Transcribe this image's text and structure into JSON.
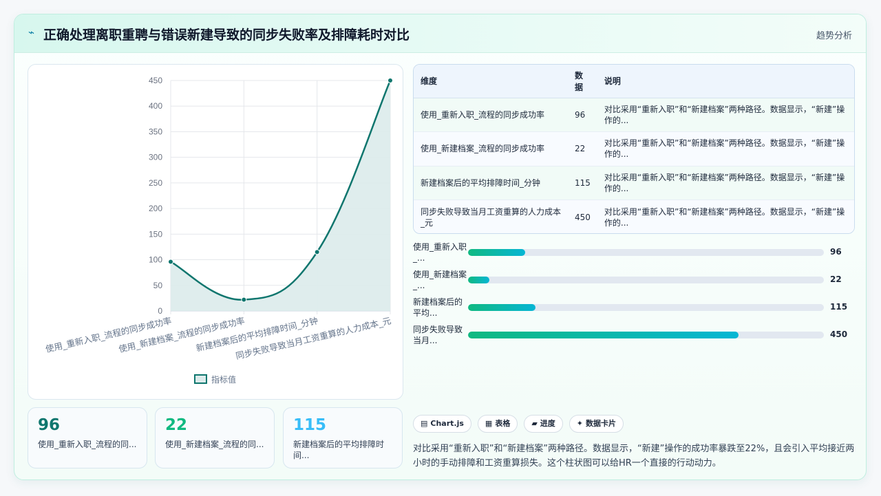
{
  "header": {
    "icon": "lightning-icon",
    "title": "正确处理离职重聘与错误新建导致的同步失败率及排障耗时对比",
    "tag": "趋势分析"
  },
  "chart_data": {
    "type": "line",
    "categories": [
      "使用_重新入职_流程的同步成功率",
      "使用_新建档案_流程的同步成功率",
      "新建档案后的平均排障时间_分钟",
      "同步失败导致当月工资重算的人力成本_元"
    ],
    "series": [
      {
        "name": "指标值",
        "values": [
          96,
          22,
          115,
          450
        ]
      }
    ],
    "ylim": [
      0,
      450
    ],
    "yticks": [
      0,
      50,
      100,
      150,
      200,
      250,
      300,
      350,
      400,
      450
    ],
    "grid": true,
    "legend": "bottom",
    "color": "#0f766e",
    "fill": "#dcebeb"
  },
  "table": {
    "headers": [
      "维度",
      "数据",
      "说明"
    ],
    "rows": [
      {
        "dim": "使用_重新入职_流程的同步成功率",
        "value": "96",
        "note": "对比采用“重新入职”和“新建档案”两种路径。数据显示，“新建”操作的..."
      },
      {
        "dim": "使用_新建档案_流程的同步成功率",
        "value": "22",
        "note": "对比采用“重新入职”和“新建档案”两种路径。数据显示，“新建”操作的..."
      },
      {
        "dim": "新建档案后的平均排障时间_分钟",
        "value": "115",
        "note": "对比采用“重新入职”和“新建档案”两种路径。数据显示，“新建”操作的..."
      },
      {
        "dim": "同步失败导致当月工资重算的人力成本_元",
        "value": "450",
        "note": "对比采用“重新入职”和“新建档案”两种路径。数据显示，“新建”操作的..."
      }
    ]
  },
  "progress": [
    {
      "label": "使用_重新入职_...",
      "value": "96",
      "fraction": 0.16
    },
    {
      "label": "使用_新建档案_...",
      "value": "22",
      "fraction": 0.06
    },
    {
      "label": "新建档案后的平均...",
      "value": "115",
      "fraction": 0.19
    },
    {
      "label": "同步失败导致当月...",
      "value": "450",
      "fraction": 0.76
    }
  ],
  "stats": [
    {
      "value": "96",
      "label": "使用_重新入职_流程的同...",
      "color": "#0f766e"
    },
    {
      "value": "22",
      "label": "使用_新建档案_流程的同...",
      "color": "#10b981"
    },
    {
      "value": "115",
      "label": "新建档案后的平均排障时间...",
      "color": "#38bdf8"
    }
  ],
  "chips": [
    {
      "icon": "chart-icon",
      "glyph": "▤",
      "label": "Chart.js"
    },
    {
      "icon": "table-icon",
      "glyph": "▦",
      "label": "表格"
    },
    {
      "icon": "progress-icon",
      "glyph": "▰",
      "label": "进度"
    },
    {
      "icon": "sparkle-icon",
      "glyph": "✦",
      "label": "数据卡片"
    }
  ],
  "description": "对比采用“重新入职”和“新建档案”两种路径。数据显示，“新建”操作的成功率暴跌至22%，且会引入平均接近两小时的手动排障和工资重算损失。这个柱状图可以给HR一个直接的行动动力。"
}
